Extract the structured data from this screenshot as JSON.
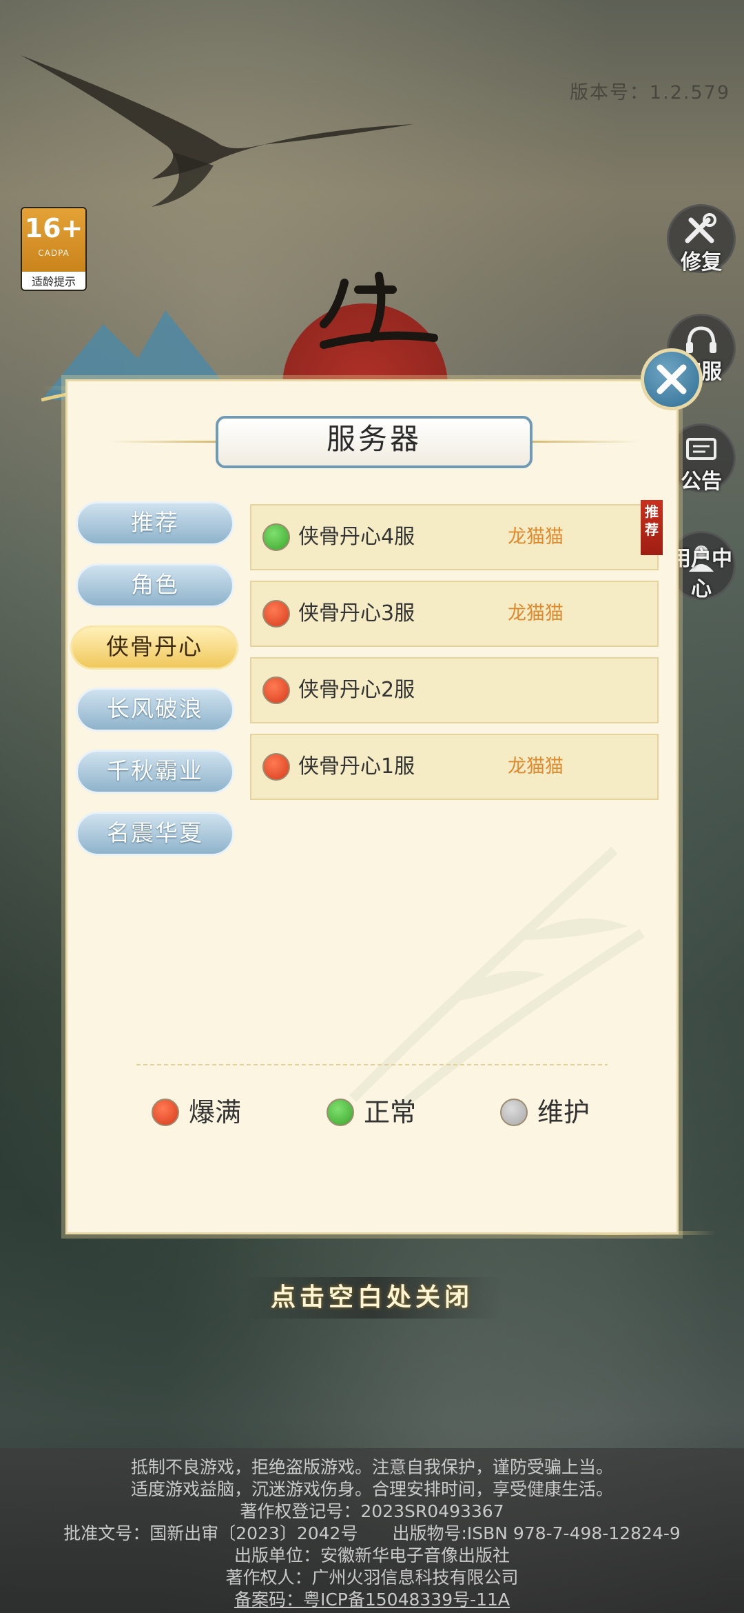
{
  "version": "版本号：1.2.579",
  "age_badge": {
    "number": "16+",
    "org": "CADPA",
    "caption": "适龄提示"
  },
  "side_buttons": [
    {
      "label": "修复",
      "icon": "wrench-screwdriver-icon"
    },
    {
      "label": "客服",
      "icon": "headset-icon"
    },
    {
      "label": "公告",
      "icon": "board-icon"
    },
    {
      "label": "用户中心",
      "icon": "user-icon"
    }
  ],
  "dialog": {
    "title": "服务器",
    "close_icon": "close-icon",
    "categories": [
      {
        "label": "推荐",
        "active": false
      },
      {
        "label": "角色",
        "active": false
      },
      {
        "label": "侠骨丹心",
        "active": true
      },
      {
        "label": "长风破浪",
        "active": false
      },
      {
        "label": "千秋霸业",
        "active": false
      },
      {
        "label": "名震华夏",
        "active": false
      }
    ],
    "servers": [
      {
        "name": "侠骨丹心4服",
        "owner": "龙猫猫",
        "status": "green",
        "tag": "推荐"
      },
      {
        "name": "侠骨丹心3服",
        "owner": "龙猫猫",
        "status": "red"
      },
      {
        "name": "侠骨丹心2服",
        "owner": "",
        "status": "red"
      },
      {
        "name": "侠骨丹心1服",
        "owner": "龙猫猫",
        "status": "red"
      }
    ],
    "legend": [
      {
        "label": "爆满",
        "status": "red"
      },
      {
        "label": "正常",
        "status": "green"
      },
      {
        "label": "维护",
        "status": "gray"
      }
    ]
  },
  "close_hint": "点击空白处关闭",
  "footer": [
    "抵制不良游戏，拒绝盗版游戏。注意自我保护，谨防受骗上当。",
    "适度游戏益脑，沉迷游戏伤身。合理安排时间，享受健康生活。",
    "著作权登记号：2023SR0493367",
    "批准文号：国新出审〔2023〕2042号　　出版物号:ISBN 978-7-498-12824-9",
    "出版单位：安徽新华电子音像出版社",
    "著作权人：广州火羽信息科技有限公司",
    "备案码：粤ICP备15048339号-11A"
  ],
  "colors": {
    "accent_blue": "#6f9ab5",
    "gold": "#e7cf86",
    "owner_orange": "#e08a30",
    "status_red": "#d63c1c",
    "status_green": "#3ba62c",
    "status_gray": "#a8a8a8"
  }
}
